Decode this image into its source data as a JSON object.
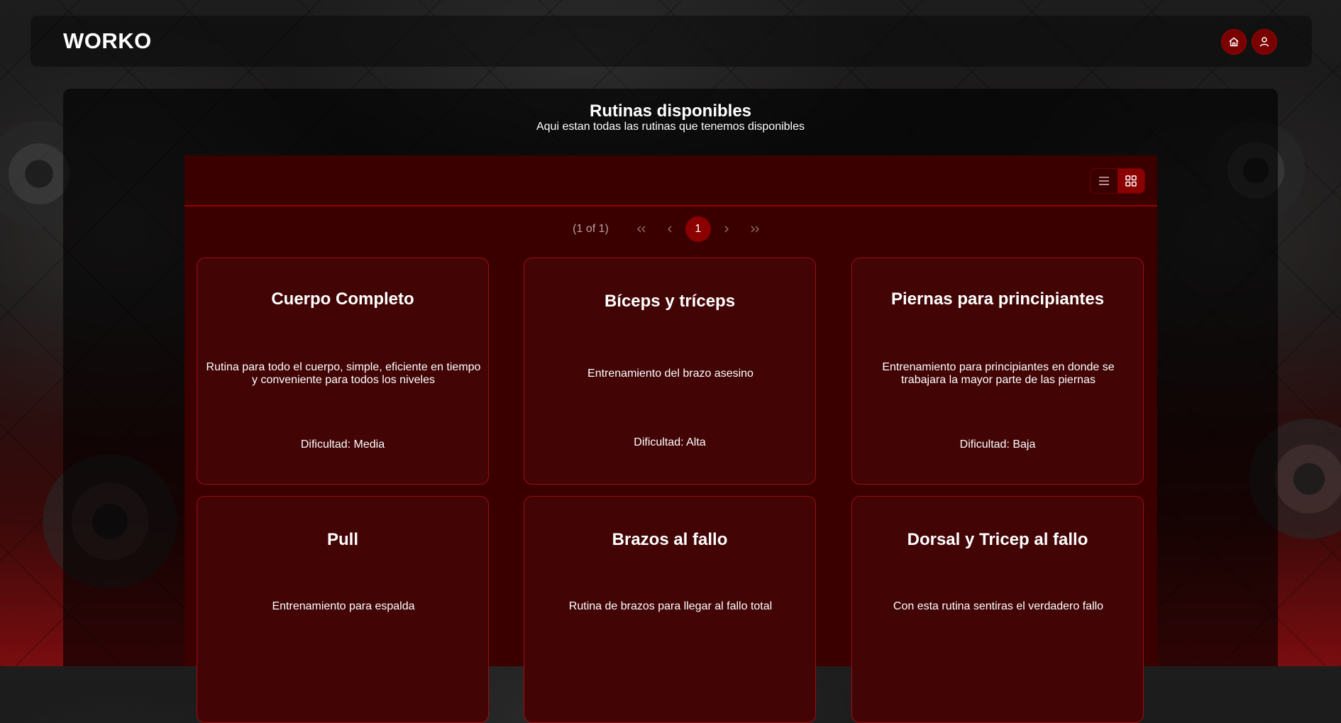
{
  "header": {
    "logo": "WORKO",
    "icons": [
      "home-icon",
      "user-icon"
    ]
  },
  "page": {
    "title": "Rutinas disponibles",
    "subtitle": "Aqui estan todas las rutinas que tenemos disponibles"
  },
  "layout_toggle": {
    "options": [
      "list-icon",
      "grid-icon"
    ],
    "active": "grid"
  },
  "paginator": {
    "report": "(1 of 1)",
    "current_page": "1",
    "nav_icons": [
      "first-page-icon",
      "prev-page-icon",
      "next-page-icon",
      "last-page-icon"
    ]
  },
  "routines": [
    {
      "title": "Cuerpo Completo",
      "description": "Rutina para todo el cuerpo, simple, eficiente en tiempo y conveniente para todos los niveles",
      "difficulty": "Dificultad: Media"
    },
    {
      "title": "Bíceps y tríceps",
      "description": "Entrenamiento del brazo asesino",
      "difficulty": "Dificultad: Alta"
    },
    {
      "title": "Piernas para principiantes",
      "description": "Entrenamiento para principiantes en donde se trabajara la mayor parte de las piernas",
      "difficulty": "Dificultad: Baja"
    },
    {
      "title": "Pull",
      "description": "Entrenamiento para espalda"
    },
    {
      "title": "Brazos al fallo",
      "description": "Rutina de brazos para llegar al fallo total"
    },
    {
      "title": "Dorsal y Tricep al fallo",
      "description": "Con esta rutina sentiras el verdadero fallo"
    }
  ],
  "colors": {
    "accent": "#8b0000",
    "card_bg": "#420405",
    "card_border": "#a00d10",
    "panel_bg": "#3a0000"
  }
}
